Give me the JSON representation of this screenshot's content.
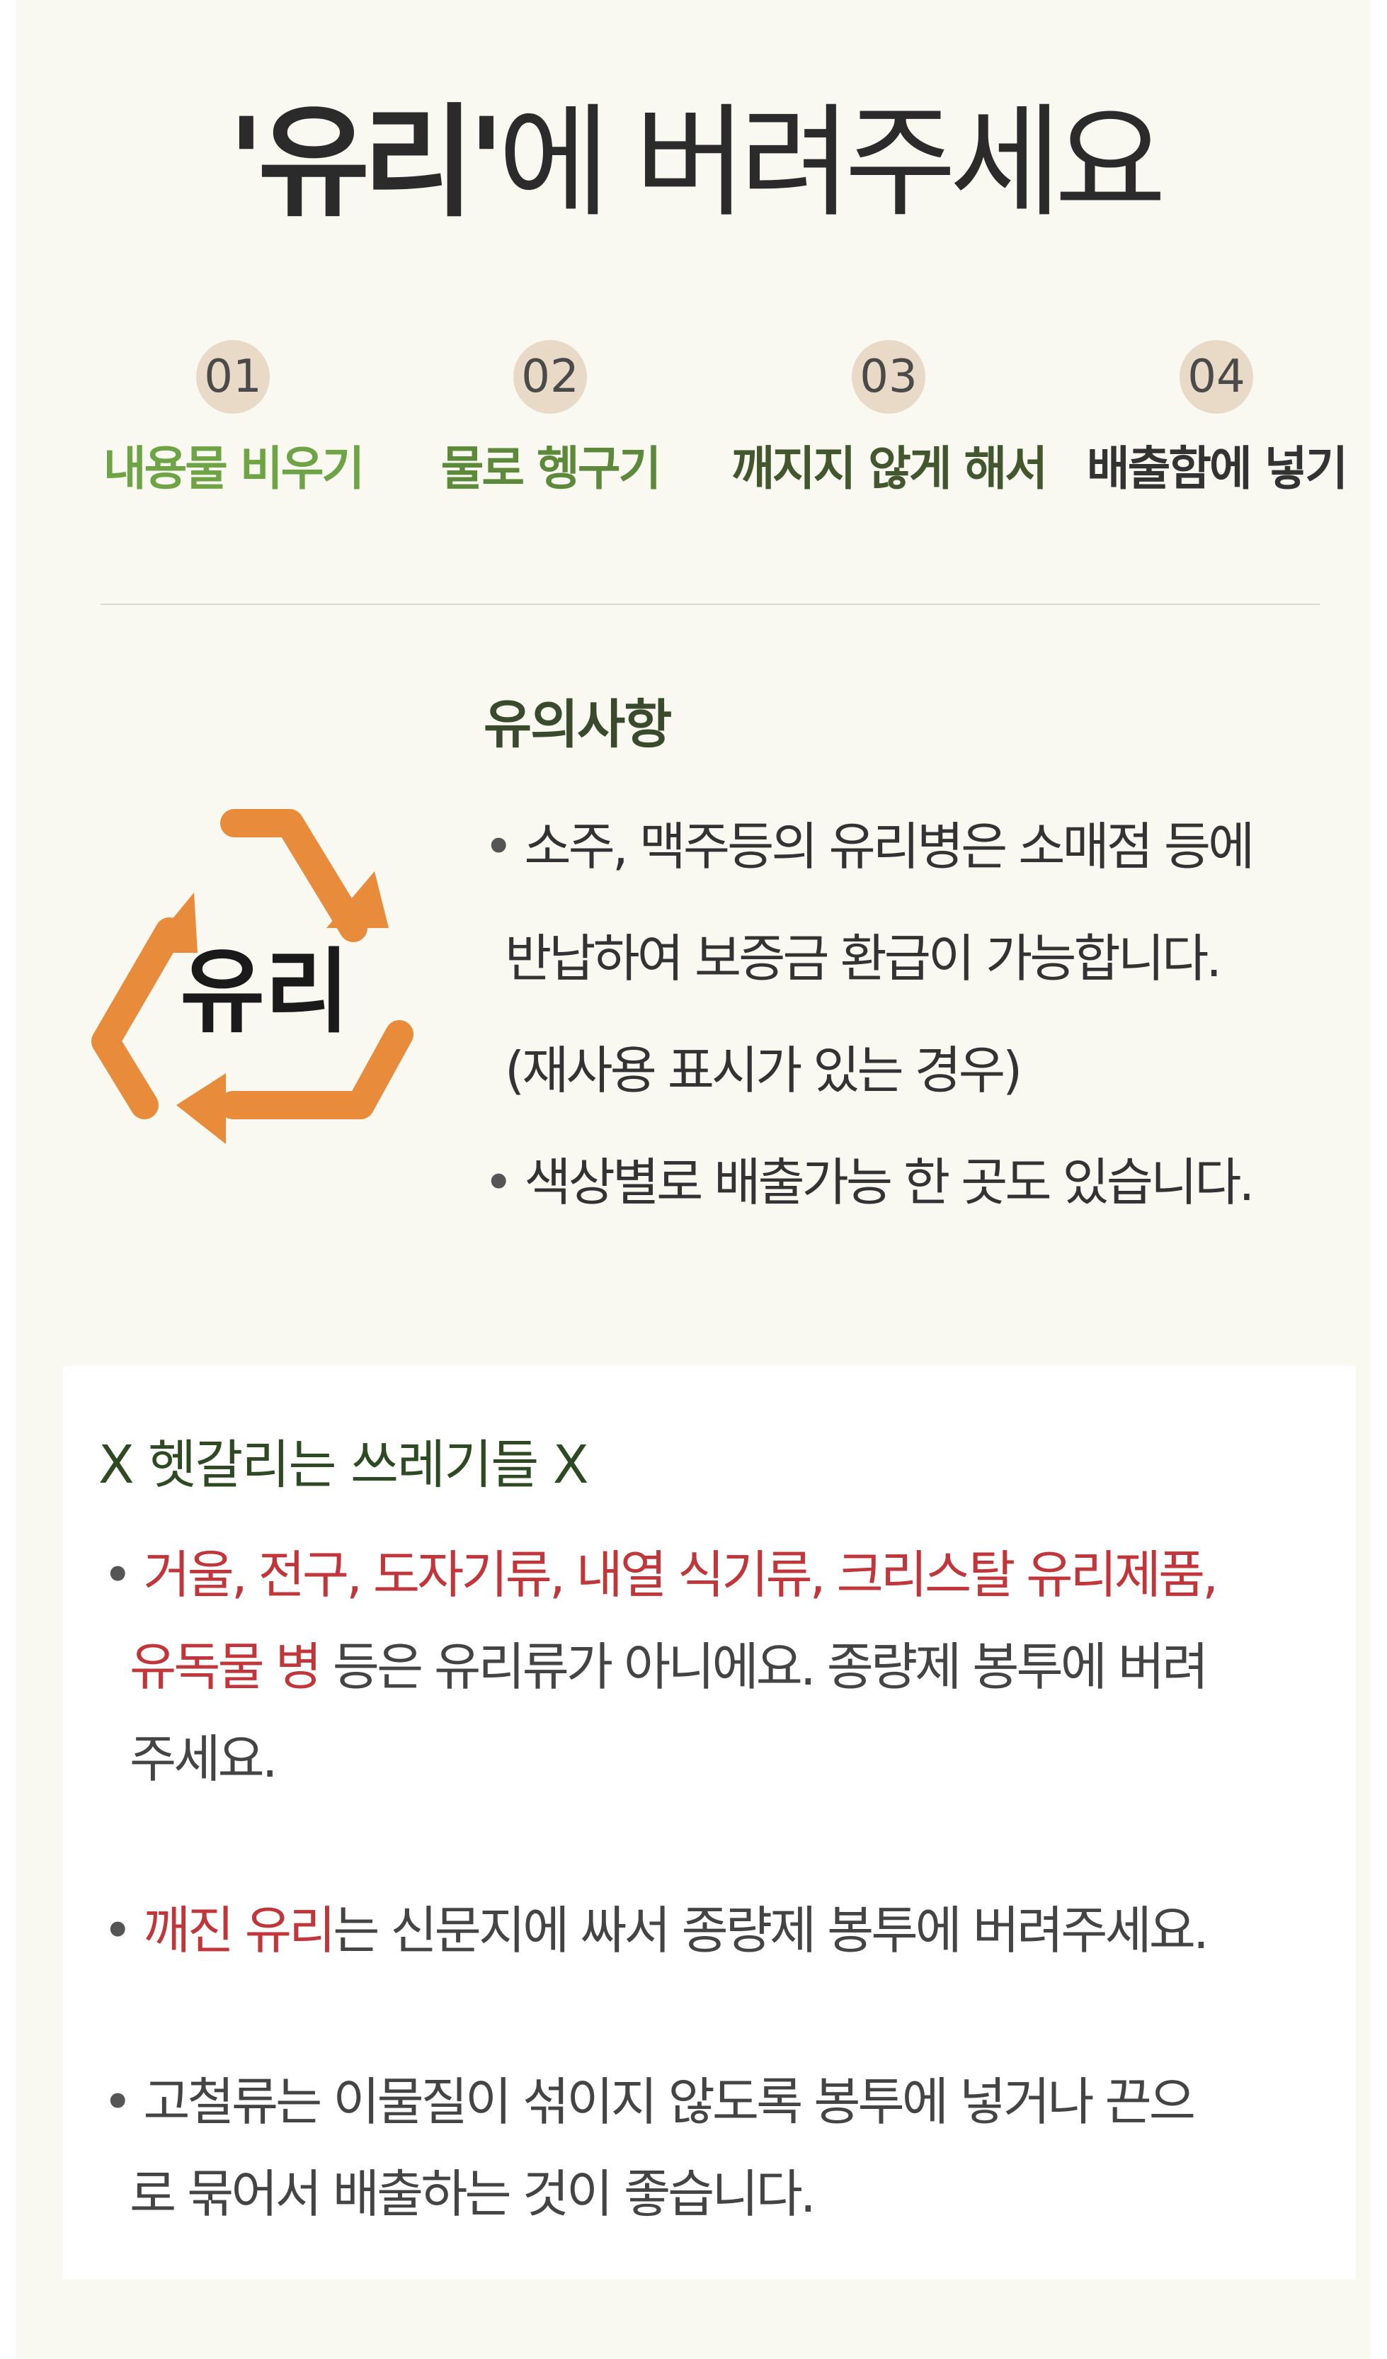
{
  "title": {
    "quoted": "'유리'",
    "rest": "에 버려주세요"
  },
  "steps": [
    {
      "num": "01",
      "label": "내용물 비우기",
      "color": "#6ea445"
    },
    {
      "num": "02",
      "label": "물로 헹구기",
      "color": "#5c8a3a"
    },
    {
      "num": "03",
      "label": "깨지지 않게 해서",
      "color": "#42572d"
    },
    {
      "num": "04",
      "label": "배출함에 넣기",
      "color": "#333333"
    }
  ],
  "logo": {
    "text": "유리",
    "icon": "recycle-arrows-icon",
    "arrow_color": "#e88b3a"
  },
  "notice": {
    "title": "유의사항",
    "bullet": "•",
    "lines": [
      "소주, 맥주등의 유리병은 소매점 등에",
      "반납하여 보증금 환급이 가능합니다.",
      "(재사용 표시가 있는 경우)",
      "색상별로 배출가능 한 곳도 있습니다."
    ]
  },
  "confusing": {
    "title": "X 헷갈리는 쓰레기들 X",
    "bullet": "•",
    "item1": {
      "red_line1": "거울, 전구, 도자기류, 내열 식기류, 크리스탈 유리제품,",
      "red_line2": "유독물 병",
      "rest_line2": " 등은 유리류가 아니에요. 종량제 봉투에 버려",
      "line3": "주세요."
    },
    "item2": {
      "red": "깨진 유리",
      "rest": "는 신문지에 싸서 종량제 봉투에 버려주세요."
    },
    "item3": {
      "line1": "고철류는 이물질이 섞이지 않도록 봉투에 넣거나 끈으",
      "line2": "로 묶어서 배출하는 것이 좋습니다."
    },
    "accent_color": "#c0363a"
  }
}
